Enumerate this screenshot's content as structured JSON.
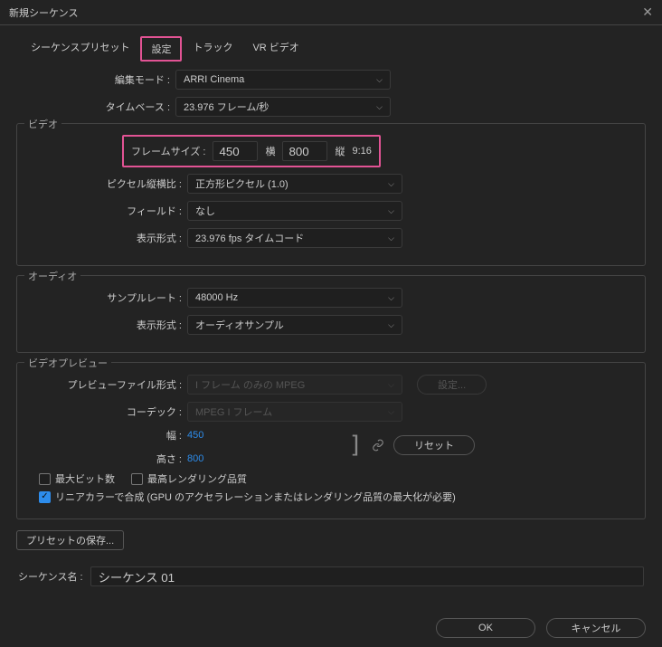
{
  "window": {
    "title": "新規シーケンス"
  },
  "tabs": {
    "presets": "シーケンスプリセット",
    "settings": "設定",
    "tracks": "トラック",
    "vr": "VR ビデオ"
  },
  "settings": {
    "editMode": {
      "label": "編集モード :",
      "value": "ARRI Cinema"
    },
    "timebase": {
      "label": "タイムベース :",
      "value": "23.976 フレーム/秒"
    }
  },
  "video": {
    "legend": "ビデオ",
    "frameSize": {
      "label": "フレームサイズ :",
      "w": "450",
      "wLabel": "横",
      "h": "800",
      "hLabel": "縦",
      "aspect": "9:16"
    },
    "pixelAspect": {
      "label": "ピクセル縦横比 :",
      "value": "正方形ピクセル (1.0)"
    },
    "fields": {
      "label": "フィールド :",
      "value": "なし"
    },
    "displayFormat": {
      "label": "表示形式 :",
      "value": "23.976 fps タイムコード"
    }
  },
  "audio": {
    "legend": "オーディオ",
    "sampleRate": {
      "label": "サンプルレート :",
      "value": "48000 Hz"
    },
    "displayFormat": {
      "label": "表示形式 :",
      "value": "オーディオサンプル"
    }
  },
  "preview": {
    "legend": "ビデオプレビュー",
    "fileFormat": {
      "label": "プレビューファイル形式 :",
      "value": "I フレーム のみの MPEG"
    },
    "codec": {
      "label": "コーデック :",
      "value": "MPEG I フレーム"
    },
    "width": {
      "label": "幅 :",
      "value": "450"
    },
    "height": {
      "label": "高さ :",
      "value": "800"
    },
    "configure": "設定...",
    "reset": "リセット"
  },
  "checks": {
    "maxBit": "最大ビット数",
    "maxRender": "最高レンダリング品質",
    "linear": "リニアカラーで合成 (GPU のアクセラレーションまたはレンダリング品質の最大化が必要)"
  },
  "savePreset": "プリセットの保存...",
  "sequence": {
    "label": "シーケンス名 :",
    "value": "シーケンス 01"
  },
  "buttons": {
    "ok": "OK",
    "cancel": "キャンセル"
  }
}
